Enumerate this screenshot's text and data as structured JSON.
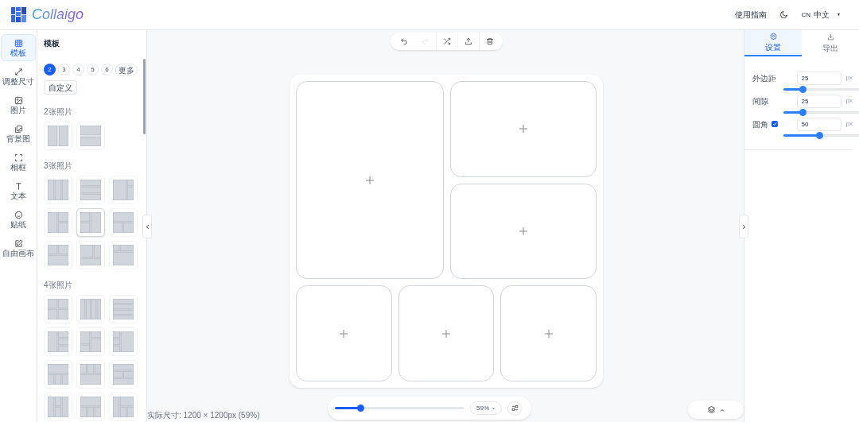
{
  "header": {
    "logo_text": "Collaigo",
    "guide": "使用指南",
    "lang_code": "CN",
    "lang": "中文",
    "lang_caret": "▾"
  },
  "rail": [
    {
      "label": "模板",
      "selected": true
    },
    {
      "label": "调整尺寸",
      "selected": false
    },
    {
      "label": "图片",
      "selected": false
    },
    {
      "label": "背景图",
      "selected": false
    },
    {
      "label": "相框",
      "selected": false
    },
    {
      "label": "文本",
      "selected": false
    },
    {
      "label": "贴纸",
      "selected": false
    },
    {
      "label": "自由画布",
      "selected": false
    }
  ],
  "panel": {
    "title": "模板",
    "counts": [
      {
        "label": "2",
        "selected": true
      },
      {
        "label": "3",
        "selected": false
      },
      {
        "label": "4",
        "selected": false
      },
      {
        "label": "5",
        "selected": false
      },
      {
        "label": "6",
        "selected": false
      },
      {
        "label": "更多",
        "selected": false
      }
    ],
    "custom": "自定义",
    "groups": [
      {
        "title": "2张照片",
        "templates": [
          {
            "selected": false
          },
          {
            "selected": false
          }
        ]
      },
      {
        "title": "3张照片",
        "templates": [
          {
            "selected": false
          },
          {
            "selected": false
          },
          {
            "selected": false
          },
          {
            "selected": false
          },
          {
            "selected": true
          },
          {
            "selected": false
          },
          {
            "selected": false
          },
          {
            "selected": false
          },
          {
            "selected": false
          }
        ]
      },
      {
        "title": "4张照片",
        "templates": [
          {
            "selected": false
          },
          {
            "selected": false
          },
          {
            "selected": false
          },
          {
            "selected": false
          },
          {
            "selected": false
          },
          {
            "selected": false
          },
          {
            "selected": false
          },
          {
            "selected": false
          },
          {
            "selected": false
          },
          {
            "selected": false
          },
          {
            "selected": false
          },
          {
            "selected": false
          }
        ]
      }
    ]
  },
  "toolbar": [
    {
      "kind": "undo",
      "disabled": false
    },
    {
      "kind": "redo",
      "disabled": true
    },
    {
      "kind": "shuffle",
      "disabled": false
    },
    {
      "kind": "upload",
      "disabled": false
    },
    {
      "kind": "delete",
      "disabled": false
    }
  ],
  "canvas": {
    "cells": [
      {
        "kind": "slot"
      },
      {
        "kind": "slot"
      },
      {
        "kind": "slot"
      },
      {
        "kind": "slot"
      },
      {
        "kind": "slot"
      },
      {
        "kind": "slot"
      }
    ]
  },
  "zoom": {
    "level": 0.2,
    "value": "59%",
    "caret": "⌄"
  },
  "status": "实际尺寸: 1200 × 1200px (59%)",
  "tabs": [
    {
      "label": "设置",
      "kind": "settings",
      "selected": true
    },
    {
      "label": "导出",
      "kind": "export",
      "selected": false
    }
  ],
  "settings": [
    {
      "label": "外边距",
      "value": "25",
      "unit": "px",
      "level": 0.24
    },
    {
      "label": "间隙",
      "value": "25",
      "unit": "px",
      "level": 0.24
    },
    {
      "label": "圆角",
      "checked": true,
      "value": "50",
      "unit": "px",
      "level": 0.45
    }
  ]
}
